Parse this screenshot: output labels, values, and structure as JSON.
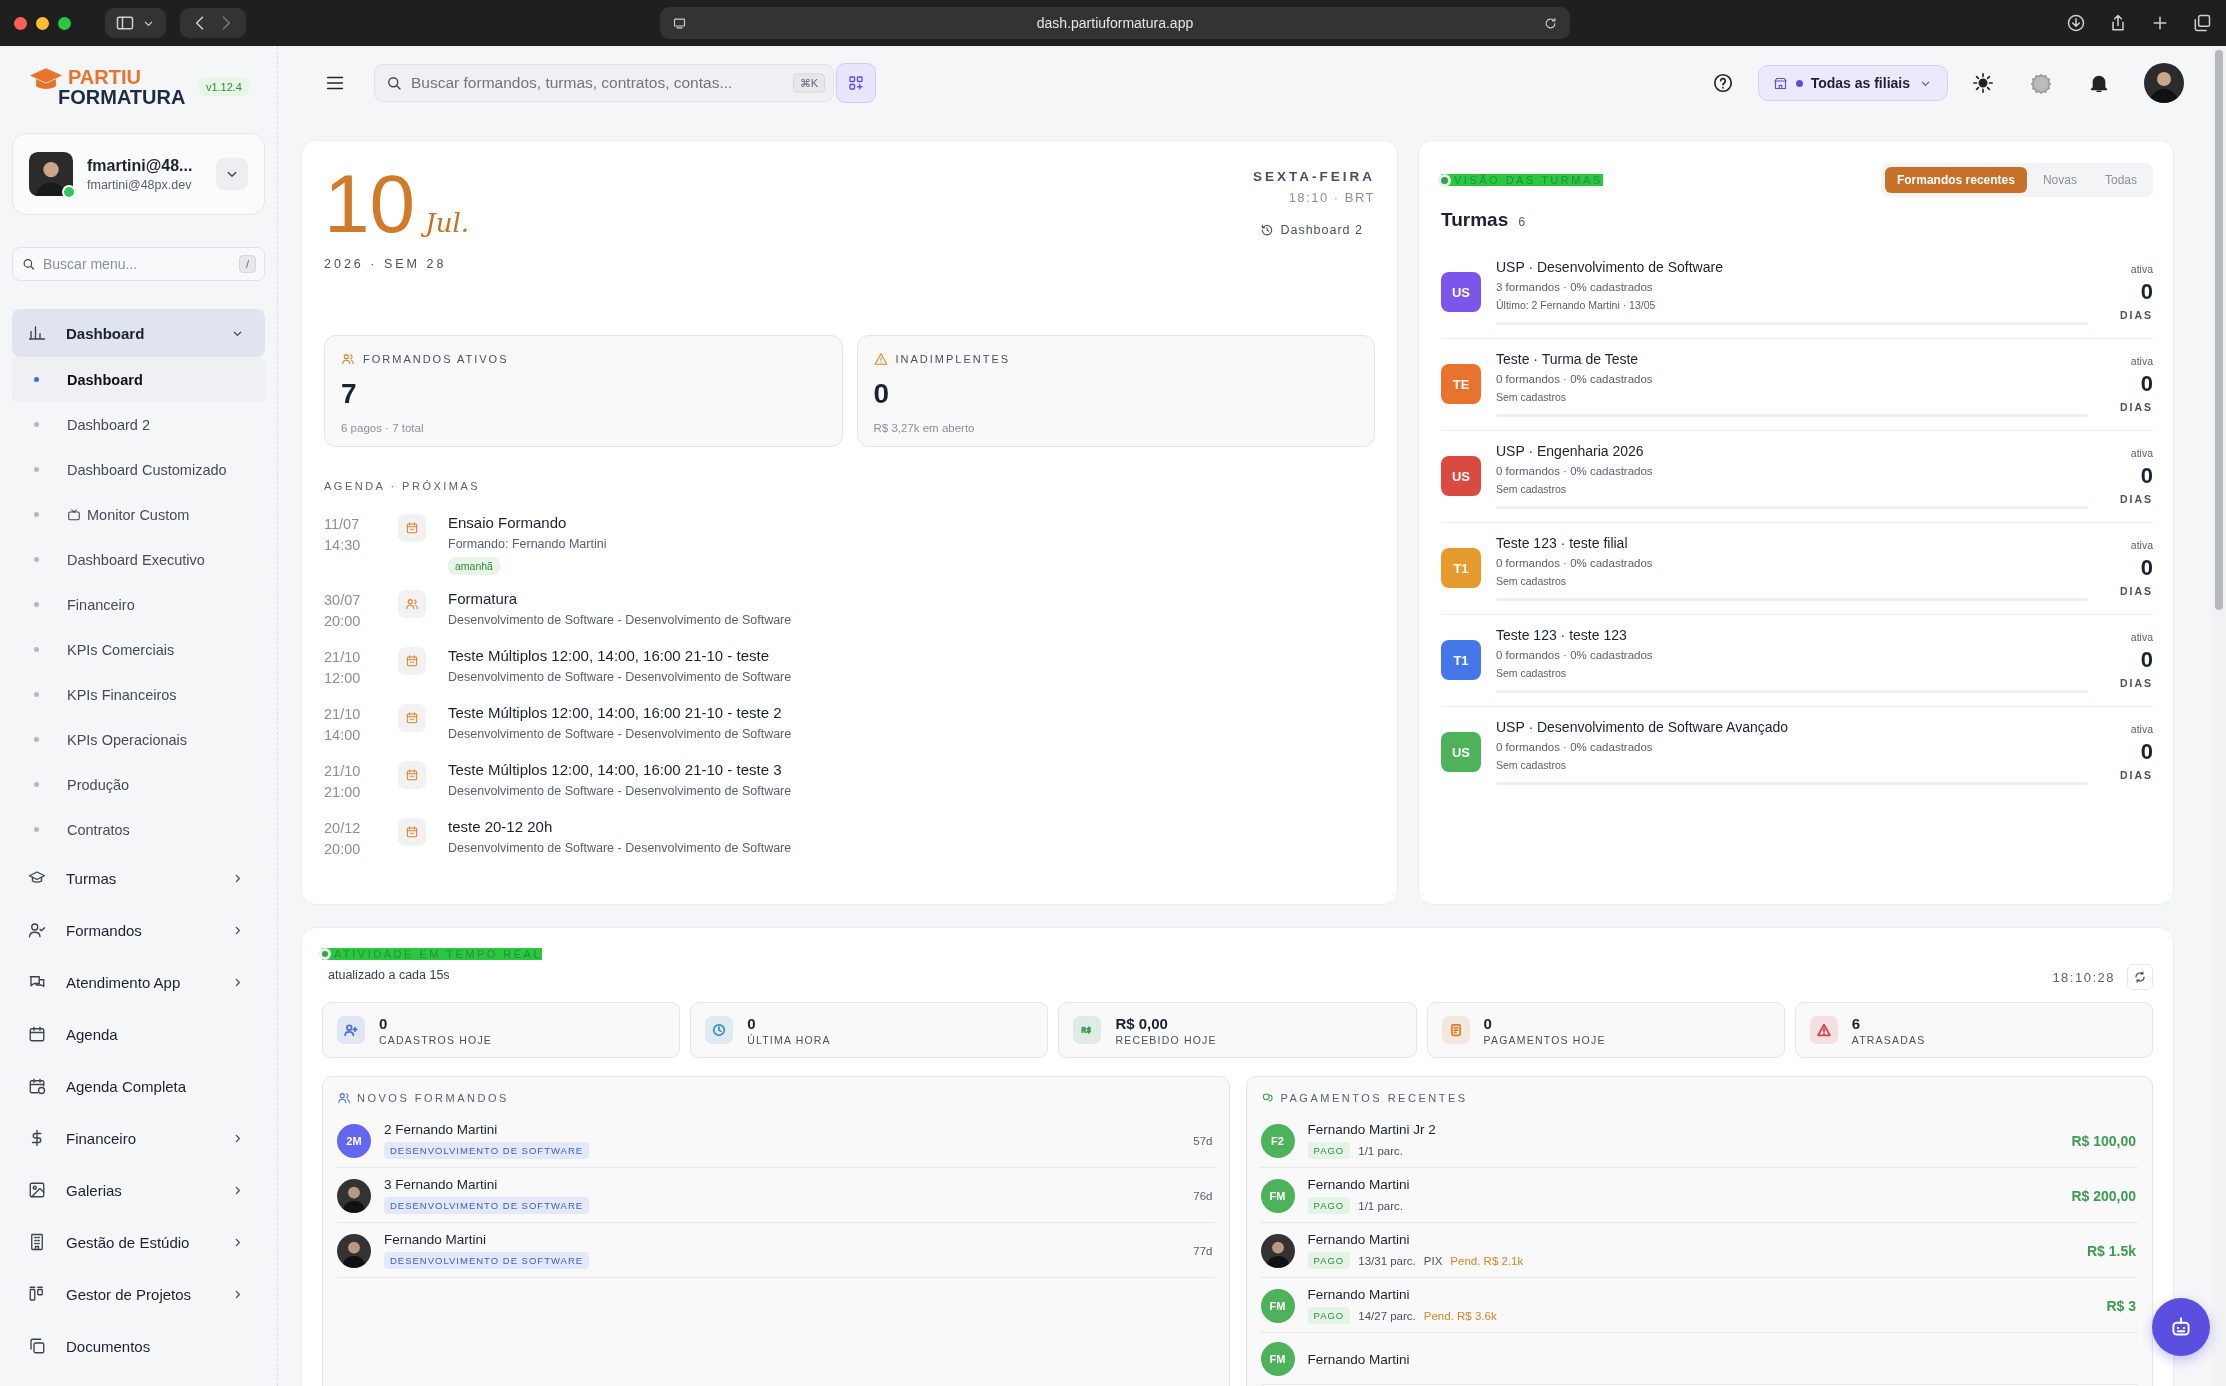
{
  "browser": {
    "url": "dash.partiuformatura.app"
  },
  "sidebar": {
    "logo_top": "PARTIU",
    "logo_bottom": "FORMATURA",
    "version": "v1.12.4",
    "user": {
      "name": "fmartini@48...",
      "email": "fmartini@48px.dev",
      "online": true
    },
    "search": {
      "placeholder": "Buscar menu...",
      "shortcut": "/"
    },
    "items": [
      {
        "label": "Dashboard",
        "kind": "group",
        "expanded": true,
        "selected": true,
        "children": [
          {
            "label": "Dashboard",
            "kind": "plain",
            "selected": true
          },
          {
            "label": "Dashboard 2",
            "kind": "plain",
            "selected": false
          },
          {
            "label": "Dashboard Customizado",
            "kind": "plain",
            "selected": false
          },
          {
            "label": "Monitor Custom",
            "kind": "with-icon",
            "selected": false
          },
          {
            "label": "Dashboard Executivo",
            "kind": "plain",
            "selected": false
          },
          {
            "label": "Financeiro",
            "kind": "plain",
            "selected": false
          },
          {
            "label": "KPIs Comerciais",
            "kind": "plain",
            "selected": false
          },
          {
            "label": "KPIs Financeiros",
            "kind": "plain",
            "selected": false
          },
          {
            "label": "KPIs Operacionais",
            "kind": "plain",
            "selected": false
          },
          {
            "label": "Produção",
            "kind": "plain",
            "selected": false
          },
          {
            "label": "Contratos",
            "kind": "plain",
            "selected": false
          }
        ]
      },
      {
        "label": "Turmas",
        "kind": "group",
        "expanded": false,
        "selected": false
      },
      {
        "label": "Formandos",
        "kind": "group",
        "expanded": false,
        "selected": false
      },
      {
        "label": "Atendimento App",
        "kind": "group",
        "expanded": false,
        "selected": false
      },
      {
        "label": "Agenda",
        "kind": "link",
        "selected": false
      },
      {
        "label": "Agenda Completa",
        "kind": "link",
        "selected": false
      },
      {
        "label": "Financeiro",
        "kind": "group",
        "expanded": false,
        "selected": false
      },
      {
        "label": "Galerias",
        "kind": "group",
        "expanded": false,
        "selected": false
      },
      {
        "label": "Gestão de Estúdio",
        "kind": "group",
        "expanded": false,
        "selected": false
      },
      {
        "label": "Gestor de Projetos",
        "kind": "group",
        "expanded": false,
        "selected": false
      },
      {
        "label": "Documentos",
        "kind": "link",
        "selected": false
      }
    ]
  },
  "header": {
    "search": {
      "placeholder": "Buscar formandos, turmas, contratos, contas...",
      "shortcut": "⌘K"
    },
    "branch": "Todas as filiais"
  },
  "today": {
    "day": "10",
    "month": "Jul.",
    "year_week": "2026 · SEM 28",
    "weekday": "SEXTA-FEIRA",
    "time": "18:10 · BRT",
    "link": "Dashboard 2",
    "stats": [
      {
        "kind": "people",
        "label": "FORMANDOS ATIVOS",
        "value": "7",
        "sub": "6 pagos · 7 total"
      },
      {
        "kind": "warning",
        "label": "INADIMPLENTES",
        "value": "0",
        "sub": "R$ 3,27k em aberto"
      }
    ],
    "agenda_title": "AGENDA · PRÓXIMAS",
    "events": [
      {
        "kind": "calendar",
        "date": "11/07",
        "time": "14:30",
        "title": "Ensaio Formando",
        "subtitle": "Formando: Fernando Martini",
        "tag": "amanhã"
      },
      {
        "kind": "people",
        "date": "30/07",
        "time": "20:00",
        "title": "Formatura",
        "subtitle": "Desenvolvimento de Software - Desenvolvimento de Software"
      },
      {
        "kind": "calendar",
        "date": "21/10",
        "time": "12:00",
        "title": "Teste Múltiplos 12:00, 14:00, 16:00 21-10 - teste",
        "subtitle": "Desenvolvimento de Software - Desenvolvimento de Software"
      },
      {
        "kind": "calendar",
        "date": "21/10",
        "time": "14:00",
        "title": "Teste Múltiplos 12:00, 14:00, 16:00 21-10 - teste 2",
        "subtitle": "Desenvolvimento de Software - Desenvolvimento de Software"
      },
      {
        "kind": "calendar",
        "date": "21/10",
        "time": "21:00",
        "title": "Teste Múltiplos 12:00, 14:00, 16:00 21-10 - teste 3",
        "subtitle": "Desenvolvimento de Software - Desenvolvimento de Software"
      },
      {
        "kind": "calendar",
        "date": "20/12",
        "time": "20:00",
        "title": "teste 20-12 20h",
        "subtitle": "Desenvolvimento de Software - Desenvolvimento de Software"
      }
    ]
  },
  "turmas": {
    "eyebrow": "VISÃO DAS TURMAS",
    "title": "Turmas",
    "count": "6",
    "tabs": [
      {
        "label": "Formandos recentes",
        "selected": true
      },
      {
        "label": "Novas",
        "selected": false
      },
      {
        "label": "Todas",
        "selected": false
      }
    ],
    "rows": [
      {
        "initials": "US",
        "color": "#7c55ea",
        "name": "USP · Desenvolvimento de Software",
        "meta": "3 formandos · 0% cadastrados",
        "last": "Último: 2 Fernando Martini · 13/05",
        "status": "ativa",
        "days": "0",
        "unit": "DIAS",
        "level": 0
      },
      {
        "initials": "TE",
        "color": "#e8732c",
        "name": "Teste · Turma de Teste",
        "meta": "0 formandos · 0% cadastrados",
        "last": "Sem cadastros",
        "status": "ativa",
        "days": "0",
        "unit": "DIAS",
        "level": 0
      },
      {
        "initials": "US",
        "color": "#d94b40",
        "name": "USP · Engenharia 2026",
        "meta": "0 formandos · 0% cadastrados",
        "last": "Sem cadastros",
        "status": "ativa",
        "days": "0",
        "unit": "DIAS",
        "level": 0
      },
      {
        "initials": "T1",
        "color": "#e59b2e",
        "name": "Teste 123 · teste filial",
        "meta": "0 formandos · 0% cadastrados",
        "last": "Sem cadastros",
        "status": "ativa",
        "days": "0",
        "unit": "DIAS",
        "level": 0
      },
      {
        "initials": "T1",
        "color": "#4577e8",
        "name": "Teste 123 · teste 123",
        "meta": "0 formandos · 0% cadastrados",
        "last": "Sem cadastros",
        "status": "ativa",
        "days": "0",
        "unit": "DIAS",
        "level": 0
      },
      {
        "initials": "US",
        "color": "#4db25a",
        "name": "USP · Desenvolvimento de Software Avançado",
        "meta": "0 formandos · 0% cadastrados",
        "last": "Sem cadastros",
        "status": "ativa",
        "days": "0",
        "unit": "DIAS",
        "level": 0
      }
    ]
  },
  "activity": {
    "eyebrow": "ATIVIDADE EM TEMPO REAL",
    "sub": "atualizado a cada 15s",
    "time": "18:10:28",
    "metrics": [
      {
        "value": "0",
        "label": "CADASTROS HOJE",
        "color": "#4a6fdc"
      },
      {
        "value": "0",
        "label": "ÚLTIMA HORA",
        "color": "#3d8fc4"
      },
      {
        "value": "R$ 0,00",
        "label": "RECEBIDO HOJE",
        "color": "#3f9a52"
      },
      {
        "value": "0",
        "label": "PAGAMENTOS HOJE",
        "color": "#d9822b"
      },
      {
        "value": "6",
        "label": "ATRASADAS",
        "color": "#d6404a"
      }
    ]
  },
  "new_students": {
    "title": "NOVOS FORMANDOS",
    "rows": [
      {
        "kind": "initials",
        "initials": "2M",
        "color": "#6366f1",
        "name": "2 Fernando Martini",
        "tag": "DESENVOLVIMENTO DE SOFTWARE",
        "age": "57d"
      },
      {
        "kind": "photo",
        "name": "3 Fernando Martini",
        "tag": "DESENVOLVIMENTO DE SOFTWARE",
        "age": "76d"
      },
      {
        "kind": "photo",
        "name": "Fernando Martini",
        "tag": "DESENVOLVIMENTO DE SOFTWARE",
        "age": "77d"
      }
    ]
  },
  "payments": {
    "title": "PAGAMENTOS RECENTES",
    "rows": [
      {
        "kind": "initials",
        "initials": "F2",
        "name": "Fernando Martini Jr 2",
        "status": "PAGO",
        "installments": "1/1 parc.",
        "amount": "R$ 100,00"
      },
      {
        "kind": "initials",
        "initials": "FM",
        "name": "Fernando Martini",
        "status": "PAGO",
        "installments": "1/1 parc.",
        "amount": "R$ 200,00"
      },
      {
        "kind": "photo",
        "name": "Fernando Martini",
        "status": "PAGO",
        "installments": "13/31 parc.",
        "method": "PIX",
        "pending": "Pend. R$ 2.1k",
        "amount": "R$ 1.5k"
      },
      {
        "kind": "initials",
        "initials": "FM",
        "name": "Fernando Martini",
        "status": "PAGO",
        "installments": "14/27 parc.",
        "pending": "Pend. R$ 3.6k",
        "amount": "R$ 3"
      },
      {
        "kind": "initials",
        "initials": "FM",
        "name": "Fernando Martini"
      }
    ]
  }
}
